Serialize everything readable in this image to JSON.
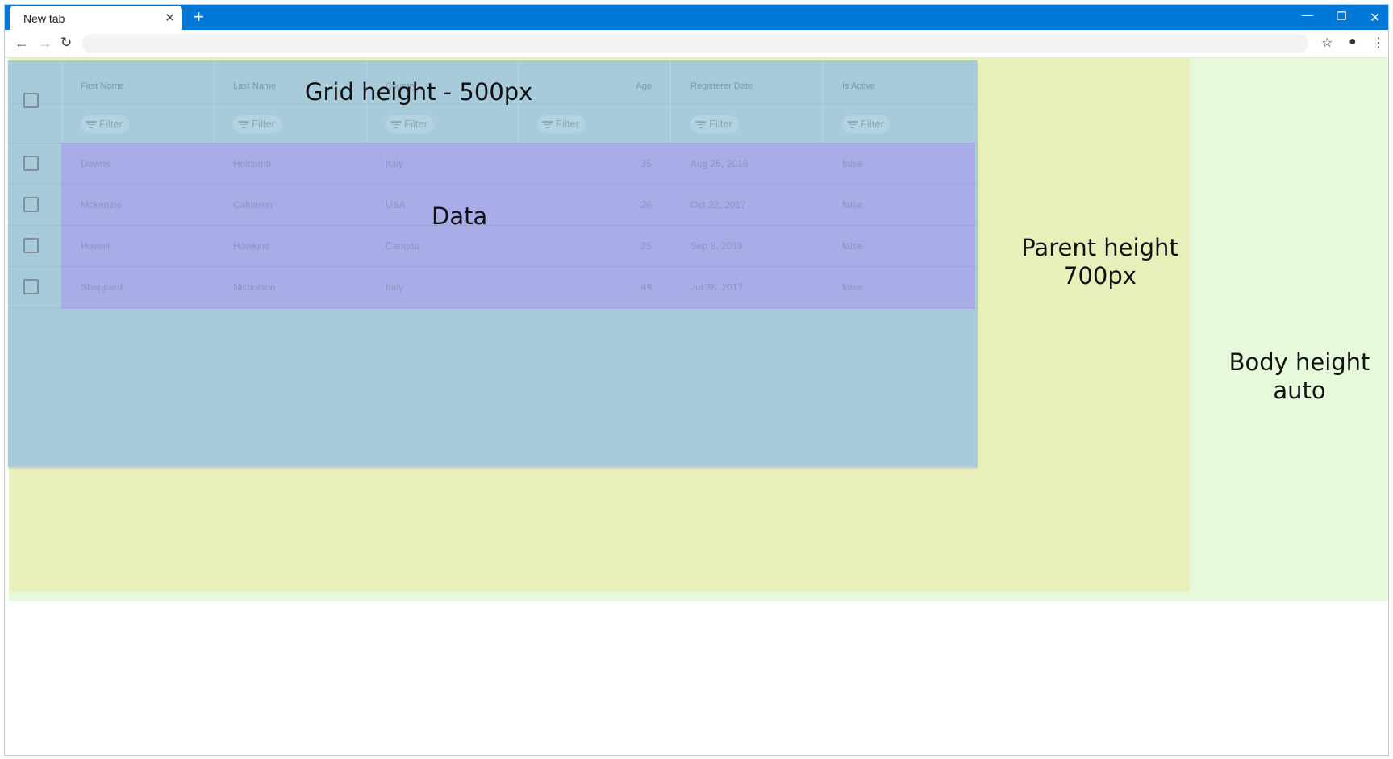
{
  "browser": {
    "tab_title": "New tab",
    "tab_close_icon": "close-icon",
    "new_tab_icon": "plus-icon",
    "window_controls": [
      "minimize-icon",
      "restore-icon",
      "close-icon"
    ],
    "address_value": "",
    "toolbar_icons": [
      "back-icon",
      "forward-icon",
      "reload-icon",
      "star-icon",
      "account-icon",
      "more-vert-icon"
    ],
    "titlebar_color": "#0078d7"
  },
  "labels": {
    "grid": "Grid height - 500px",
    "data": "Data",
    "parent_line1": "Parent height",
    "parent_line2": "700px",
    "body_line1": "Body height",
    "body_line2": "auto"
  },
  "colors": {
    "body_bg": "#e6fadb",
    "parent_bg": "#e9efbb",
    "grid_bg": "#a8cbdc",
    "data_bg": "#a8ade7"
  },
  "grid": {
    "columns": [
      {
        "key": "first_name",
        "label": "First Name",
        "filter_label": "Filter"
      },
      {
        "key": "last_name",
        "label": "Last Name",
        "filter_label": "Filter"
      },
      {
        "key": "country",
        "label": "Country",
        "filter_label": "Filter"
      },
      {
        "key": "age",
        "label": "Age",
        "filter_label": "Filter"
      },
      {
        "key": "registered",
        "label": "Registerer Date",
        "filter_label": "Filter"
      },
      {
        "key": "is_active",
        "label": "Is Active",
        "filter_label": "Filter"
      }
    ],
    "rows": [
      {
        "first_name": "Downs",
        "last_name": "Holcomb",
        "country": "Italy",
        "age": "35",
        "registered": "Aug 25, 2018",
        "is_active": "false"
      },
      {
        "first_name": "Mckenzie",
        "last_name": "Calderon",
        "country": "USA",
        "age": "26",
        "registered": "Oct 22, 2017",
        "is_active": "false"
      },
      {
        "first_name": "Howell",
        "last_name": "Hawkins",
        "country": "Canada",
        "age": "25",
        "registered": "Sep 8, 2018",
        "is_active": "false"
      },
      {
        "first_name": "Sheppard",
        "last_name": "Nicholson",
        "country": "Italy",
        "age": "49",
        "registered": "Jul 28, 2017",
        "is_active": "false"
      }
    ]
  }
}
